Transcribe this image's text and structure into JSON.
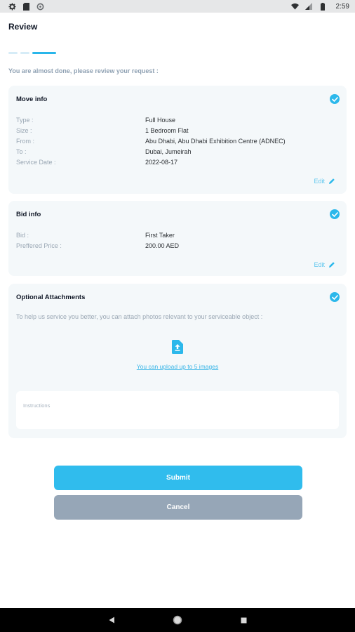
{
  "status_bar": {
    "time": "2:59",
    "left_icons": [
      "gear-icon",
      "sd-card-icon",
      "sync-icon"
    ],
    "right_icons": [
      "wifi-icon",
      "signal-icon",
      "battery-icon"
    ]
  },
  "header": {
    "title": "Review"
  },
  "progress": {
    "steps": 3,
    "current_step": 3
  },
  "intro": "You are almost done, please review your request :",
  "move_info": {
    "title": "Move info",
    "rows": [
      {
        "label": "Type :",
        "value": "Full House"
      },
      {
        "label": "Size :",
        "value": "1 Bedroom Flat"
      },
      {
        "label": "From :",
        "value": "Abu Dhabi, Abu Dhabi Exhibition Centre (ADNEC)"
      },
      {
        "label": "To :",
        "value": "Dubai, Jumeirah"
      },
      {
        "label": "Service Date :",
        "value": "2022-08-17"
      }
    ],
    "edit_label": "Edit"
  },
  "bid_info": {
    "title": "Bid info",
    "rows": [
      {
        "label": "Bid :",
        "value": "First Taker"
      },
      {
        "label": "Preffered Price :",
        "value": "200.00 AED"
      }
    ],
    "edit_label": "Edit"
  },
  "attachments": {
    "title": "Optional Attachments",
    "help_text": "To help us service you better, you can attach photos relevant to your serviceable object :",
    "upload_link": "You can upload up to 5 images",
    "instructions_placeholder": "Instructions"
  },
  "actions": {
    "submit_label": "Submit",
    "cancel_label": "Cancel"
  },
  "colors": {
    "accent": "#2cb8eb",
    "cancel": "#96a6b7",
    "card_bg": "#f4f8fa"
  }
}
